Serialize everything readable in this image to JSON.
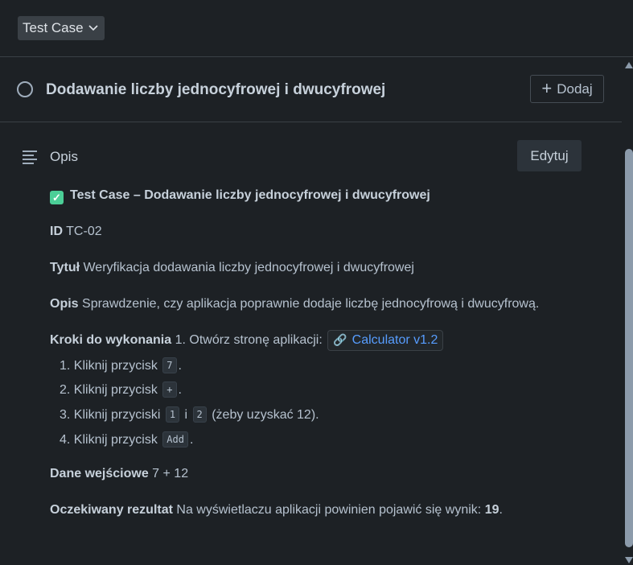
{
  "issue_type": {
    "label": "Test Case",
    "chevron": "chevron-down-icon"
  },
  "header": {
    "title": "Dodawanie liczby jednocyfrowej i dwucyfrowej",
    "add_label": "Dodaj"
  },
  "description": {
    "label": "Opis",
    "edit_label": "Edytuj",
    "heading": "Test Case – Dodawanie liczby jednocyfrowej i dwucyfrowej",
    "id_label": "ID",
    "id_value": "TC-02",
    "title_label": "Tytuł",
    "title_value": "Weryfikacja dodawania liczby jednocyfrowej i dwucyfrowej",
    "opis_label": "Opis",
    "opis_value": "Sprawdzenie, czy aplikacja poprawnie dodaje liczbę jednocyfrową i dwucyfrową.",
    "steps_label": "Kroki do wykonania",
    "step1": "1. Otwórz stronę aplikacji:",
    "link_label": "Calculator v1.2",
    "step_click": "Kliknij przycisk",
    "step_click_plural": "Kliknij przyciski",
    "num1": "1.",
    "num2": "2.",
    "num3": "3.",
    "num4": "4.",
    "key7": "7",
    "keyplus": "+",
    "key1": "1",
    "and": "i",
    "key2": "2",
    "step3_tail": "(żeby uzyskać 12).",
    "keyadd": "Add",
    "input_label": "Dane wejściowe",
    "input_value": "7 + 12",
    "result_label": "Oczekiwany rezultat",
    "result_value": "Na wyświetlaczu aplikacji powinien pojawić się wynik:",
    "result_number": "19",
    "period": ".",
    "dot": "."
  },
  "colors": {
    "background": "#1d2125",
    "text": "#b6c2cf",
    "link": "#579dff",
    "check": "#4bce97"
  }
}
